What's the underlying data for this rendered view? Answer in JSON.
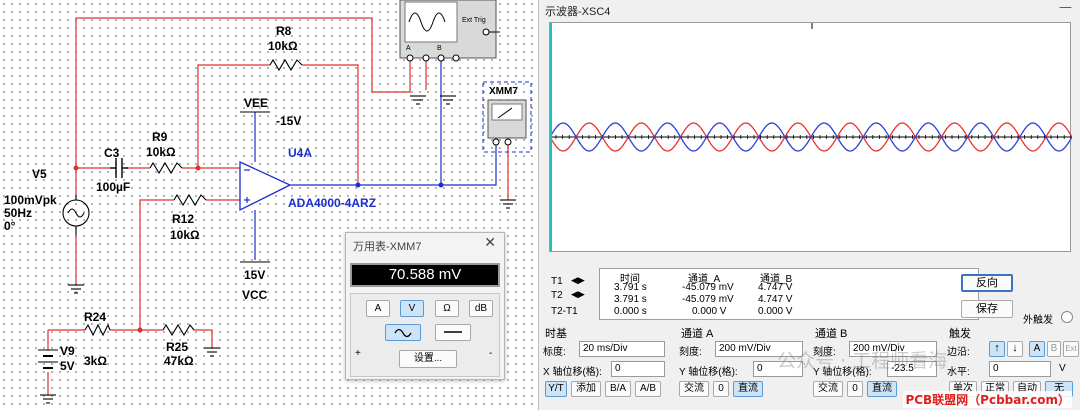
{
  "schematic": {
    "v5": {
      "ref": "V5",
      "amp": "100mVpk",
      "freq": "50Hz",
      "phase": "0°"
    },
    "c3": {
      "ref": "C3",
      "value": "100µF"
    },
    "r9": {
      "ref": "R9",
      "value": "10kΩ"
    },
    "r8": {
      "ref": "R8",
      "value": "10kΩ"
    },
    "r12": {
      "ref": "R12",
      "value": "10kΩ"
    },
    "r24": {
      "ref": "R24",
      "value": "3kΩ"
    },
    "r25": {
      "ref": "R25",
      "value": "47kΩ"
    },
    "v9": {
      "ref": "V9",
      "value": "5V"
    },
    "vee": {
      "name": "VEE",
      "value": "-15V"
    },
    "vcc": {
      "name": "VCC",
      "value": "15V"
    },
    "u4a": {
      "ref": "U4A",
      "part": "ADA4000-4ARZ"
    },
    "xmm7": {
      "ref": "XMM7"
    },
    "scope_icon": {
      "ext_trig": "Ext Trig",
      "pin_a": "A",
      "pin_b": "B"
    }
  },
  "multimeter": {
    "title": "万用表-XMM7",
    "reading": "70.588 mV",
    "modes": [
      "A",
      "V",
      "Ω",
      "dB"
    ],
    "selected_mode": "V",
    "settings_label": "设置...",
    "plus": "+",
    "minus": "-"
  },
  "oscilloscope": {
    "title": "示波器-XSC4",
    "readout": {
      "row_labels": [
        "T1",
        "T2",
        "T2-T1"
      ],
      "headers": [
        "时间",
        "通道_A",
        "通道_B"
      ],
      "rows": [
        [
          "3.791 s",
          "-45.079 mV",
          "4.747 V"
        ],
        [
          "3.791 s",
          "-45.079 mV",
          "4.747 V"
        ],
        [
          "0.000 s",
          "0.000 V",
          "0.000 V"
        ]
      ]
    },
    "buttons": {
      "reverse": "反向",
      "save": "保存",
      "ext_trigger": "外触发"
    },
    "timebase": {
      "title": "时基",
      "scale_label": "标度:",
      "scale_value": "20 ms/Div",
      "xpos_label": "X 轴位移(格):",
      "xpos_value": "0",
      "mode_buttons": [
        "Y/T",
        "添加",
        "B/A",
        "A/B"
      ]
    },
    "channel_a": {
      "title": "通道 A",
      "scale_label": "刻度:",
      "scale_value": "200 mV/Div",
      "ypos_label": "Y 轴位移(格):",
      "ypos_value": "0",
      "coupling": [
        "交流",
        "0",
        "直流"
      ]
    },
    "channel_b": {
      "title": "通道 B",
      "scale_label": "刻度:",
      "scale_value": "200 mV/Div",
      "ypos_label": "Y 轴位移(格):",
      "ypos_value": "-23.5",
      "coupling": [
        "交流",
        "0",
        "直流"
      ]
    },
    "trigger": {
      "title": "触发",
      "edge_label": "边沿:",
      "level_label": "水平:",
      "level_value": "0",
      "level_unit": "V",
      "sources": [
        "A",
        "B",
        "Ext"
      ],
      "modes": [
        "单次",
        "正常",
        "自动",
        "无"
      ]
    },
    "colors": {
      "channel_a": "#e8312f",
      "channel_b": "#2b3fd6",
      "cursor": "#20c0c0"
    }
  },
  "watermark": {
    "text": "公众号 · 工程师看海",
    "site": "PCB联盟网（Pcbbar.com）"
  }
}
